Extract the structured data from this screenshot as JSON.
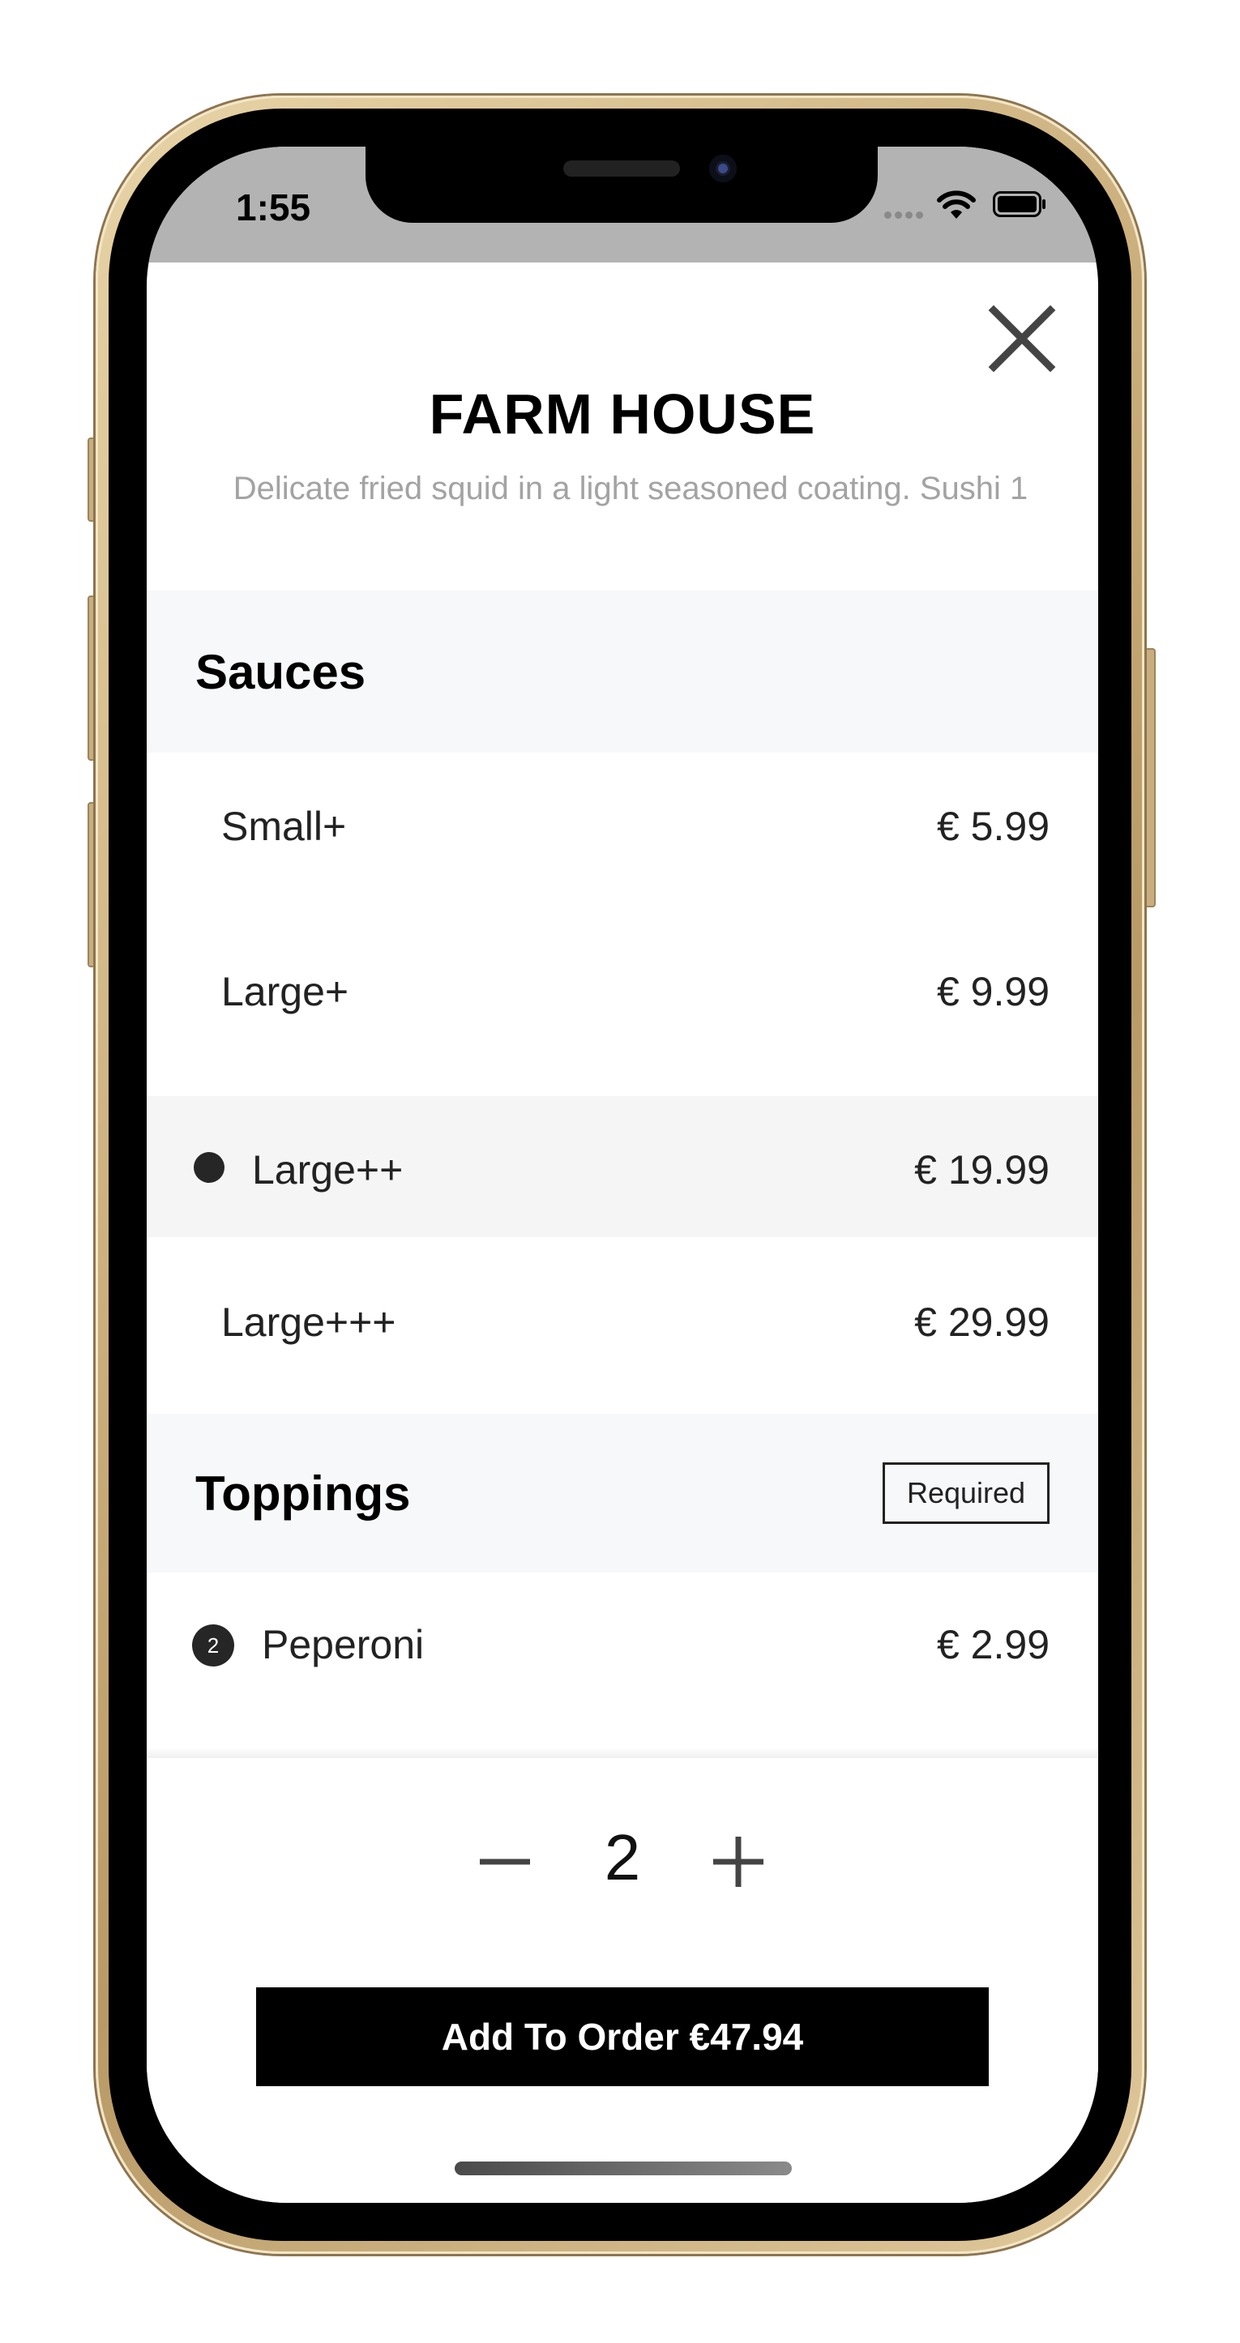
{
  "status_bar": {
    "time": "1:55",
    "icons": [
      "signal-dots-icon",
      "wifi-icon",
      "battery-icon"
    ]
  },
  "header": {
    "close_icon": "close-icon",
    "title": "FARM HOUSE",
    "description": "Delicate fried squid in a light seasoned coating. Sushi 1"
  },
  "sauces": {
    "title": "Sauces",
    "options": [
      {
        "label": "Small+",
        "price": "€ 5.99",
        "selected": false
      },
      {
        "label": "Large+",
        "price": "€ 9.99",
        "selected": false
      },
      {
        "label": "Large++",
        "price": "€ 19.99",
        "selected": true
      },
      {
        "label": "Large+++",
        "price": "€ 29.99",
        "selected": false
      }
    ]
  },
  "toppings": {
    "title": "Toppings",
    "badge": "Required",
    "items": [
      {
        "count": "2",
        "label": "Peperoni",
        "price": "€ 2.99"
      }
    ]
  },
  "quantity": {
    "minus_icon": "minus-icon",
    "value": "2",
    "plus_icon": "plus-icon"
  },
  "footer": {
    "add_button_label": "Add To Order €47.94"
  },
  "colors": {
    "section_bg": "#f7f8fa",
    "selected_row_bg": "#f5f5f5",
    "button_bg": "#000000",
    "status_bar_bg": "#b3b3b3",
    "description_text": "#a3a3a3"
  }
}
